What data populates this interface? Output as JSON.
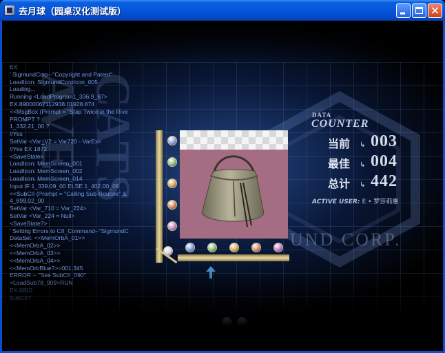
{
  "window": {
    "title": "去月球（园桌汉化测试版）",
    "controls": {
      "minimize_icon": "minimize-icon",
      "maximize_icon": "maximize-icon",
      "close_icon": "close-icon"
    }
  },
  "console_lines": [
    "EX",
    "' SigmundCorp--\"Copyright and Patent\"",
    "LoadIcon: SigmundCorpIcon_005",
    "Loading...",
    "Running <LoadProgram1_336.9_87>",
    "EX.89000067112938.01928.874",
    "<<MsgBox (Prompt = \"Stap Twice in the Rive",
    "PROMPT ?",
    "  1_332.21_00 ?",
    " //Yes",
    "SetVar <Var_V2 = Var720 - VarEx>",
    " //Yes    EX 1872",
    "<SaveState>",
    "LoadIcon: MemScreen_001",
    "LoadIcon: MemScreen_002",
    "LoadIcon: MemScreen_014",
    "Input IF 1_339.09_00 ELSE 1_402.00_09",
    "<<SubCII (Prompt = \"Calling Sub-Routine\" &",
    "  4_899.02_00",
    "SetVar <Var_710 = Var_224>",
    "SetVar <Var_224 = Null>",
    "<SaveState?>",
    "' Setting Errors to CII_Command--\"SigmundC",
    "DataSet: <<MemOrbA_01>>",
    "  <<MemOrbA_02>>",
    "  <<MemOrbA_03>>",
    "  <<MemOrbA_04>>",
    "  <<MemOrbBlue?>>001.345",
    "ERROR -- \"See SubCII_090\"",
    "<LoadSub78_909>RUN",
    "EX.0810",
    "  SubCII?"
  ],
  "vertical_deco_text": "CATS AVE",
  "watermark": "UND CORP.",
  "counter": {
    "heading_small": "DATA",
    "heading": "COUNTER",
    "rows": [
      {
        "label": "当前",
        "value": "003"
      },
      {
        "label": "最佳",
        "value": "004"
      },
      {
        "label": "总计",
        "value": "442"
      }
    ],
    "active_user_label": "ACTIVE USER:",
    "active_user_value": "E • 罗莎莉惠"
  },
  "memory_item": {
    "icon": "handbag-icon"
  },
  "orbs": {
    "left_colors": [
      "#8fa3d8",
      "#8ec07a",
      "#d8a860",
      "#d88a5a",
      "#c88ac0",
      "#d6d6e6"
    ],
    "bottom_colors": [
      "#7aa0d8",
      "#8ec07a",
      "#d8b05a",
      "#d88a6a",
      "#c07ac8"
    ]
  },
  "colors": {
    "accent": "#0555db",
    "console": "#6f95e0",
    "gold_rail": "#d8c88e",
    "pink_bg": "#a56d84"
  }
}
